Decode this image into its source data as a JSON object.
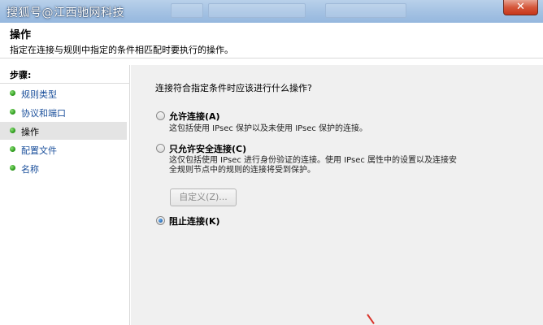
{
  "titlebar": {
    "watermark": "搜狐号@江西驰网科技",
    "close_label": "✕"
  },
  "header": {
    "title": "操作",
    "description": "指定在连接与规则中指定的条件相匹配时要执行的操作。"
  },
  "steps": {
    "label": "步骤:",
    "items": [
      {
        "label": "规则类型",
        "selected": false
      },
      {
        "label": "协议和端口",
        "selected": false
      },
      {
        "label": "操作",
        "selected": true
      },
      {
        "label": "配置文件",
        "selected": false
      },
      {
        "label": "名称",
        "selected": false
      }
    ]
  },
  "main": {
    "question": "连接符合指定条件时应该进行什么操作?",
    "options": [
      {
        "label": "允许连接(A)",
        "description": [
          "这包括使用 IPsec 保护以及未使用 IPsec 保护的连接。"
        ],
        "checked": false
      },
      {
        "label": "只允许安全连接(C)",
        "description": [
          "这仅包括使用 IPsec 进行身份验证的连接。使用 IPsec 属性中的设置以及连接安",
          "全规则节点中的规则的连接将受到保护。"
        ],
        "checked": false
      },
      {
        "label": "阻止连接(K)",
        "description": [],
        "checked": true
      }
    ],
    "custom_button": "自定义(Z)..."
  }
}
